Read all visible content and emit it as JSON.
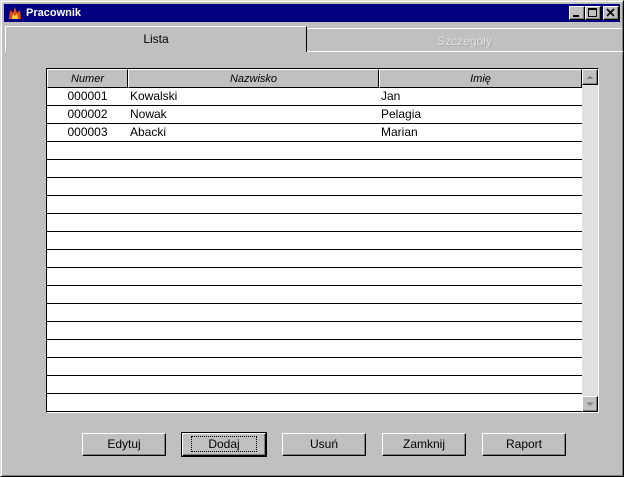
{
  "window": {
    "title": "Pracownik"
  },
  "tabs": [
    {
      "label": "Lista",
      "active": true
    },
    {
      "label": "Szczegóły",
      "active": false
    }
  ],
  "grid": {
    "columns": [
      "Numer",
      "Nazwisko",
      "Imię"
    ],
    "rows": [
      {
        "numer": "000001",
        "nazwisko": "Kowalski",
        "imie": "Jan"
      },
      {
        "numer": "000002",
        "nazwisko": "Nowak",
        "imie": "Pelagia"
      },
      {
        "numer": "000003",
        "nazwisko": "Abacki",
        "imie": "Marian"
      }
    ],
    "empty_rows": 15
  },
  "buttons": {
    "edit": "Edytuj",
    "add": "Dodaj",
    "delete": "Usuń",
    "close": "Zamknij",
    "report": "Raport"
  },
  "icons": {
    "app": "flame-app-icon",
    "minimize": "minimize-icon",
    "maximize": "maximize-icon",
    "close": "close-icon",
    "scroll_up": "arrow-up-icon",
    "scroll_down": "arrow-down-icon"
  },
  "colors": {
    "titlebar": "#000080",
    "face": "#c0c0c0"
  }
}
